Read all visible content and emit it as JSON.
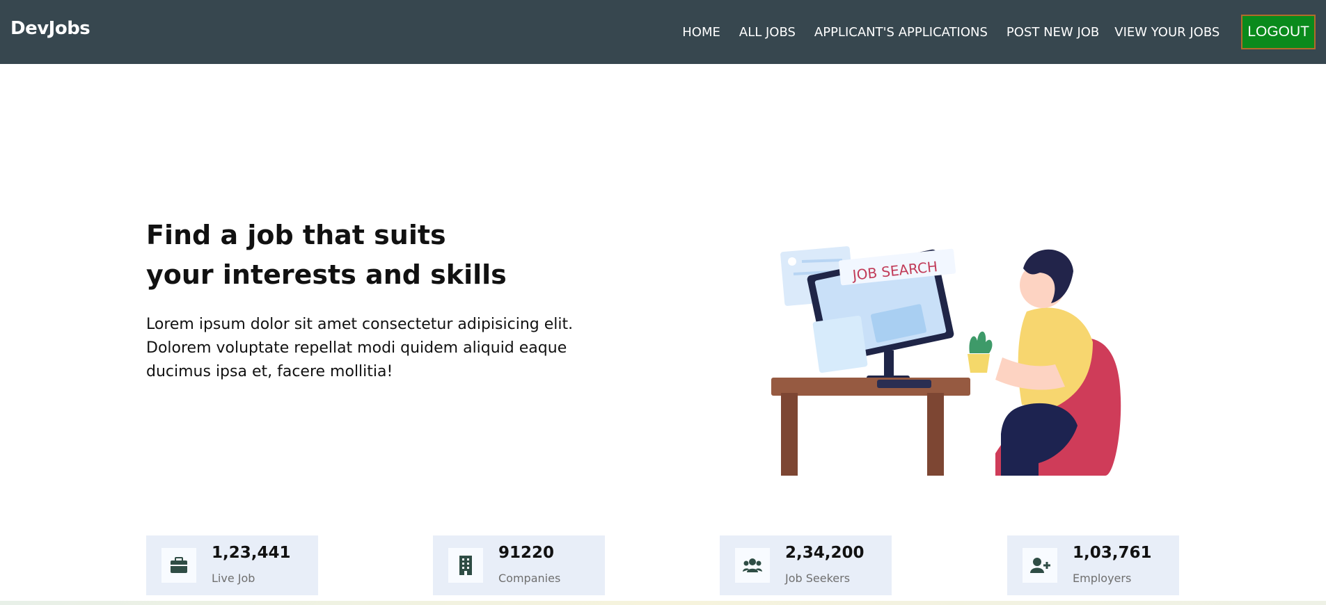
{
  "brand": "DevJobs",
  "nav": {
    "links": [
      "HOME",
      "ALL JOBS",
      "APPLICANT'S APPLICATIONS",
      "POST NEW JOB",
      "VIEW YOUR JOBS"
    ],
    "logout": "LOGOUT"
  },
  "hero": {
    "title_line1": "Find a job that suits",
    "title_line2": "your interests and skills",
    "description": "Lorem ipsum dolor sit amet consectetur adipisicing elit. Dolorem voluptate repellat modi quidem aliquid eaque ducimus ipsa et, facere mollitia!",
    "illustration_text": "JOB SEARCH"
  },
  "stats": [
    {
      "value": "1,23,441",
      "label": "Live Job",
      "icon": "briefcase-icon"
    },
    {
      "value": "91220",
      "label": "Companies",
      "icon": "building-icon"
    },
    {
      "value": "2,34,200",
      "label": "Job Seekers",
      "icon": "users-icon"
    },
    {
      "value": "1,03,761",
      "label": "Employers",
      "icon": "user-plus-icon"
    }
  ],
  "colors": {
    "navbar": "#37474f",
    "logout_bg": "#0a8a1c",
    "stat_bg": "#e8eef8",
    "icon": "#2f4d45"
  }
}
